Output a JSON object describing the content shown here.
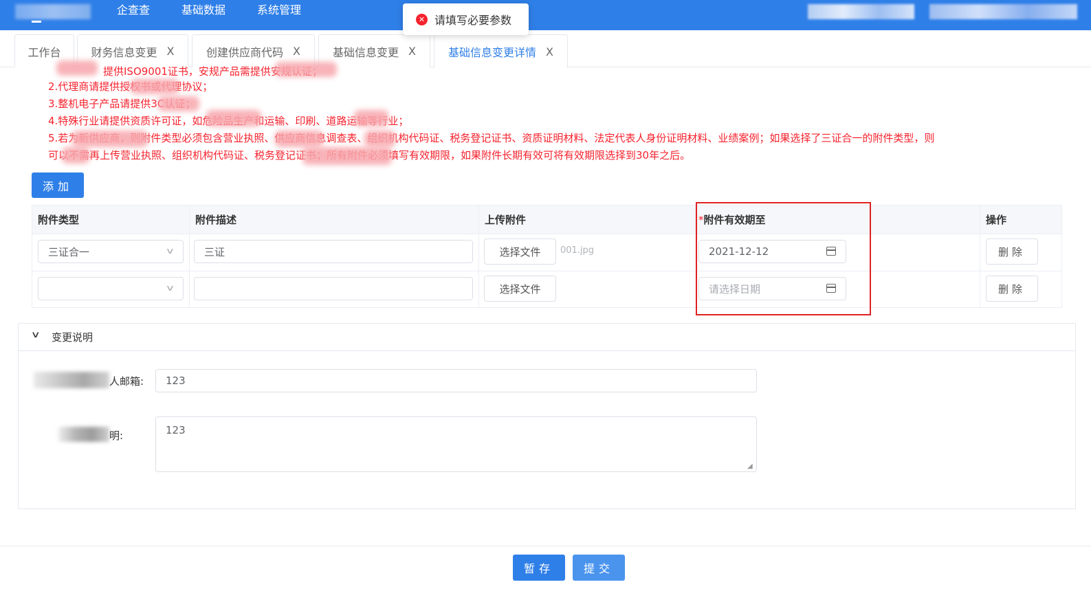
{
  "header": {
    "nav": [
      "企查查",
      "基础数据",
      "系统管理"
    ]
  },
  "toast": {
    "icon": "error-circle-icon",
    "message": "请填写必要参数"
  },
  "tabs": [
    {
      "label": "工作台",
      "closable": false
    },
    {
      "label": "财务信息变更",
      "closable": true
    },
    {
      "label": "创建供应商代码",
      "closable": true
    },
    {
      "label": "基础信息变更",
      "closable": true
    },
    {
      "label": "基础信息变更详情",
      "closable": true,
      "active": true
    }
  ],
  "tab_close": "X",
  "notice": {
    "line1": "提供ISO9001证书，安规产品需提供安规认证；",
    "line2": "2.代理商请提供授权书或代理协议；",
    "line3": "3.整机电子产品请提供3C认证；",
    "line4": "4.特殊行业请提供资质许可证，如危险品生产和运输、印刷、道路运输等行业；",
    "line5": "5.若为新供应商，则附件类型必须包含营业执照、供应商信息调查表、组织机构代码证、税务登记证书、资质证明材料、法定代表人身份证明材料、业绩案例；如果选择了三证合一的附件类型，则",
    "line6": "可以不需再上传营业执照、组织机构代码证、税务登记证书；所有附件必须填写有效期限，如果附件长期有效可将有效期限选择到30年之后。"
  },
  "add_button": "添加",
  "table": {
    "headers": [
      "附件类型",
      "附件描述",
      "上传附件",
      "附件有效期至",
      "操作"
    ],
    "required_mark": "*",
    "rows": [
      {
        "type": "三证合一",
        "desc": "三证",
        "upload_label": "选择文件",
        "file": "001.jpg",
        "expiry": "2021-12-12",
        "action": "删除"
      },
      {
        "type": "",
        "desc": "",
        "upload_label": "选择文件",
        "file": "",
        "expiry": "",
        "expiry_placeholder": "请选择日期",
        "action": "删除"
      }
    ]
  },
  "change_section": {
    "title": "变更说明",
    "email_label": "人邮箱:",
    "email_value": "123",
    "desc_label": "明:",
    "desc_value": "123"
  },
  "footer": {
    "save": "暂存",
    "submit": "提交"
  },
  "colors": {
    "primary": "#2f7fe8",
    "danger": "#f5222d",
    "highlight": "#e02020"
  }
}
